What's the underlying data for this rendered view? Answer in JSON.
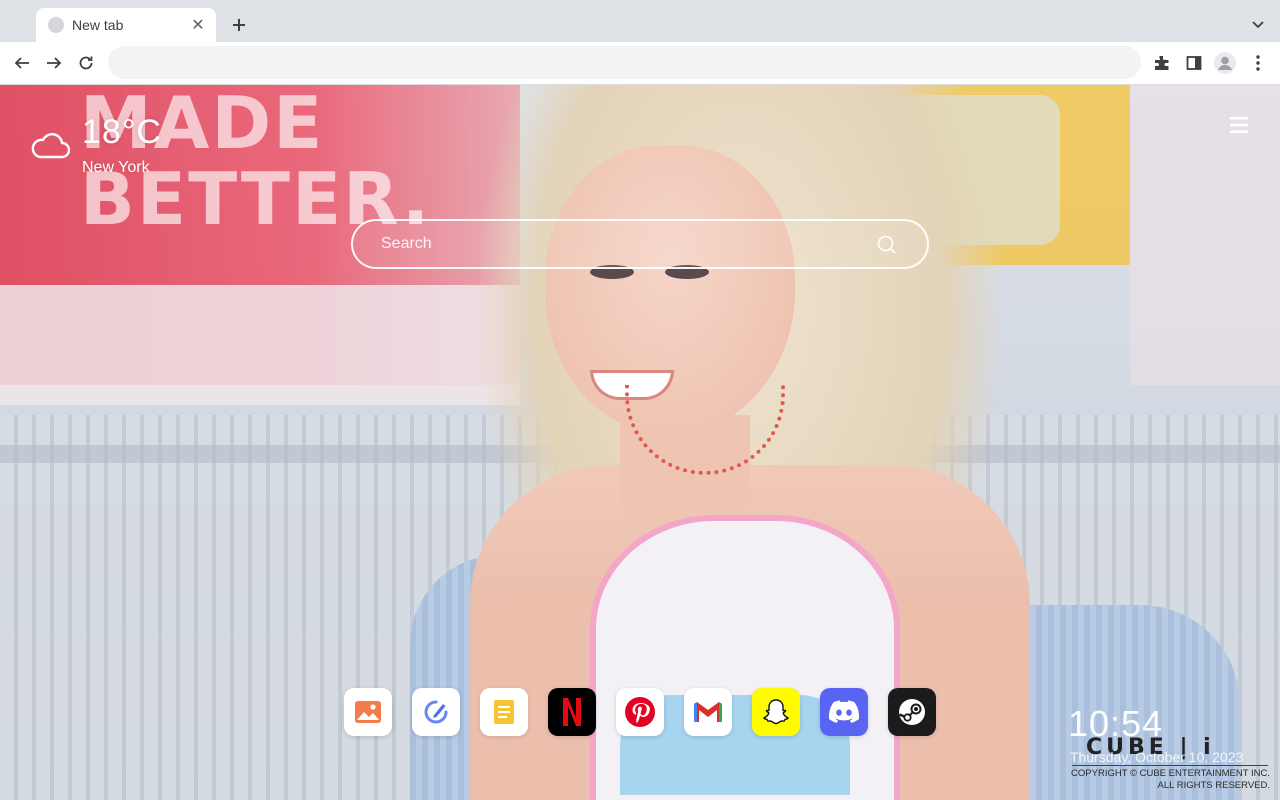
{
  "browser": {
    "tab": {
      "title": "New tab",
      "close_glyph": "✕"
    },
    "omnibox": {
      "value": "",
      "placeholder": ""
    },
    "icons": [
      "back-arrow-icon",
      "forward-arrow-icon",
      "reload-icon",
      "extensions-icon",
      "side-panel-icon",
      "profile-avatar-icon",
      "kebab-menu-icon",
      "chevron-down-icon",
      "plus-icon"
    ]
  },
  "weather": {
    "temperature": "18°C",
    "city": "New York",
    "icon": "cloud-icon"
  },
  "search": {
    "placeholder": "Search"
  },
  "dock": {
    "apps": [
      {
        "name": "gallery",
        "icon": "image-icon",
        "color": "#f26b3a"
      },
      {
        "name": "edit",
        "icon": "pencil-circle-icon",
        "color": "#5b7ff0"
      },
      {
        "name": "notes",
        "icon": "note-icon",
        "color": "#f2b824"
      },
      {
        "name": "netflix",
        "icon": "netflix-icon",
        "color": "#e50914"
      },
      {
        "name": "pinterest",
        "icon": "pinterest-icon",
        "color": "#e60023"
      },
      {
        "name": "gmail",
        "icon": "gmail-icon",
        "color": "#d93025"
      },
      {
        "name": "snapchat",
        "icon": "snapchat-icon",
        "color": "#fffc00"
      },
      {
        "name": "discord",
        "icon": "discord-icon",
        "color": "#5865f2"
      },
      {
        "name": "steam",
        "icon": "steam-icon",
        "color": "#1b1b1b"
      }
    ]
  },
  "clock": {
    "time": "10:54",
    "date": "Thursday, October 10, 2023"
  },
  "watermark": {
    "brand": "CUBE | i",
    "copyright_line1": "COPYRIGHT © CUBE ENTERTAINMENT INC.",
    "copyright_line2": "ALL RIGHTS RESERVED."
  },
  "background": {
    "deco_line1": "MADE",
    "deco_line2": "BETTER."
  }
}
